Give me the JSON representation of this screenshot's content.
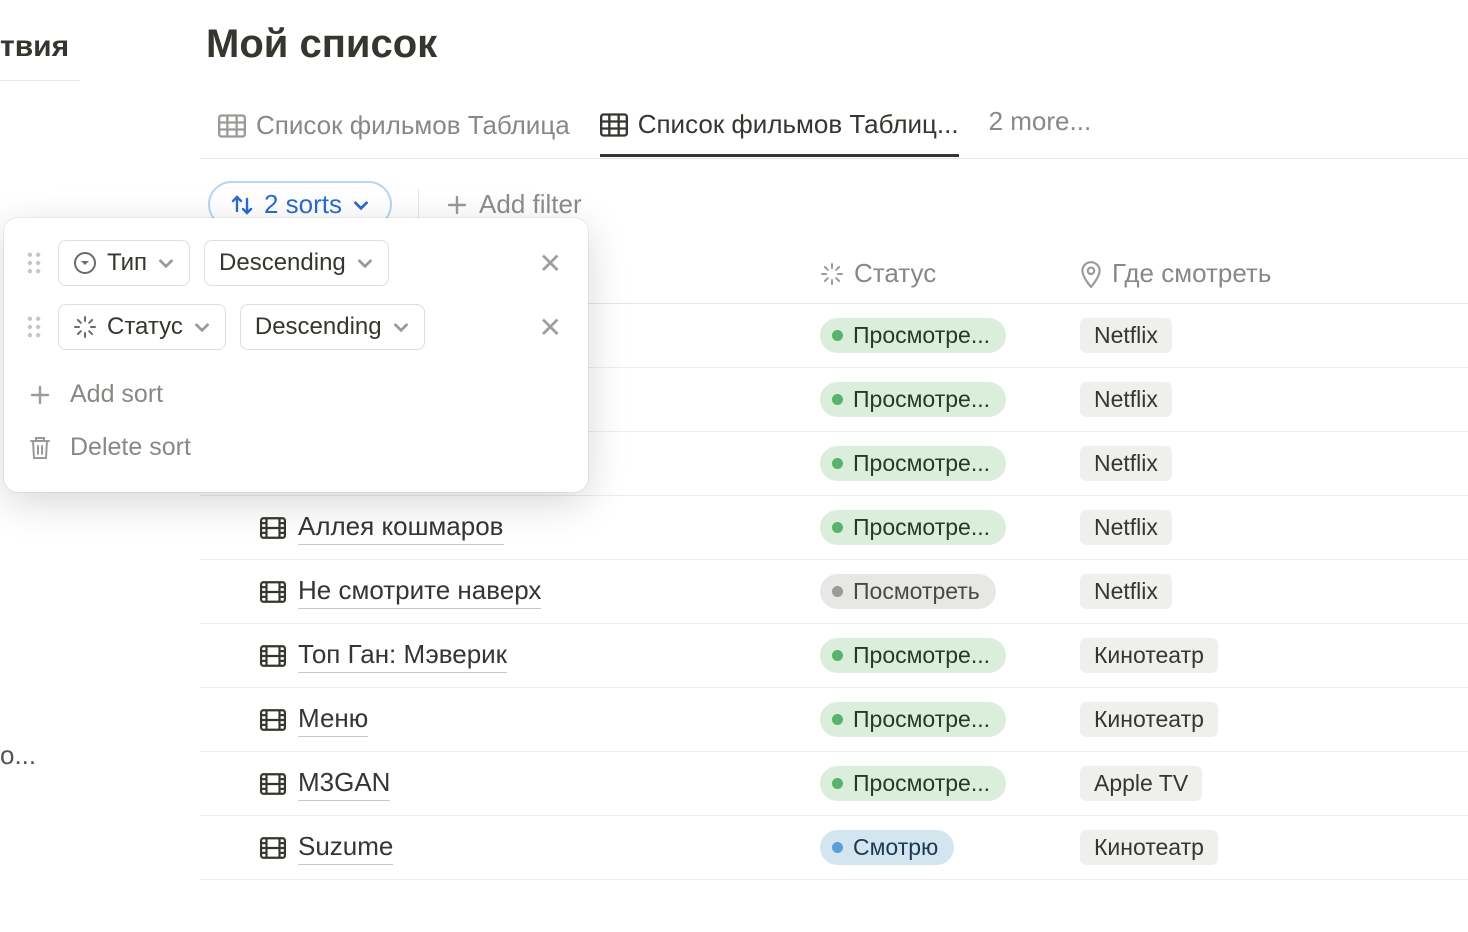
{
  "sidebar": {
    "top_fragment": "твия",
    "bottom_fragment": "о..."
  },
  "page": {
    "title": "Мой список"
  },
  "tabs": {
    "items": [
      {
        "label": "Список фильмов Таблица",
        "active": false
      },
      {
        "label": "Список фильмов Таблиц...",
        "active": true
      }
    ],
    "more": "2 more..."
  },
  "toolbar": {
    "sorts_label": "2 sorts",
    "add_filter": "Add filter"
  },
  "sort_popover": {
    "rows": [
      {
        "field": "Тип",
        "direction": "Descending",
        "field_icon": "type"
      },
      {
        "field": "Статус",
        "direction": "Descending",
        "field_icon": "spinner"
      }
    ],
    "add_sort": "Add sort",
    "delete_sort": "Delete sort"
  },
  "columns": {
    "status": "Статус",
    "where": "Где смотреть"
  },
  "status_values": {
    "watched": "Просмотре...",
    "to_watch": "Посмотреть",
    "watching": "Смотрю"
  },
  "rows": [
    {
      "title": "",
      "hidden_by_popover": true,
      "status": "watched",
      "status_color": "green",
      "where": "Netflix"
    },
    {
      "title": "",
      "hidden_by_popover": true,
      "status": "watched",
      "status_color": "green",
      "where": "Netflix"
    },
    {
      "title": "",
      "hidden_by_popover": true,
      "status": "watched",
      "status_color": "green",
      "where": "Netflix"
    },
    {
      "title": "Аллея кошмаров",
      "hidden_by_popover": false,
      "status": "watched",
      "status_color": "green",
      "where": "Netflix"
    },
    {
      "title": "Не смотрите наверх",
      "hidden_by_popover": false,
      "status": "to_watch",
      "status_color": "grey",
      "where": "Netflix"
    },
    {
      "title": "Топ Ган: Мэверик",
      "hidden_by_popover": false,
      "status": "watched",
      "status_color": "green",
      "where": "Кинотеатр"
    },
    {
      "title": "Меню",
      "hidden_by_popover": false,
      "status": "watched",
      "status_color": "green",
      "where": "Кинотеатр"
    },
    {
      "title": "M3GAN",
      "hidden_by_popover": false,
      "status": "watched",
      "status_color": "green",
      "where": "Apple TV"
    },
    {
      "title": "Suzume",
      "hidden_by_popover": false,
      "status": "watching",
      "status_color": "blue",
      "where": "Кинотеатр"
    }
  ]
}
